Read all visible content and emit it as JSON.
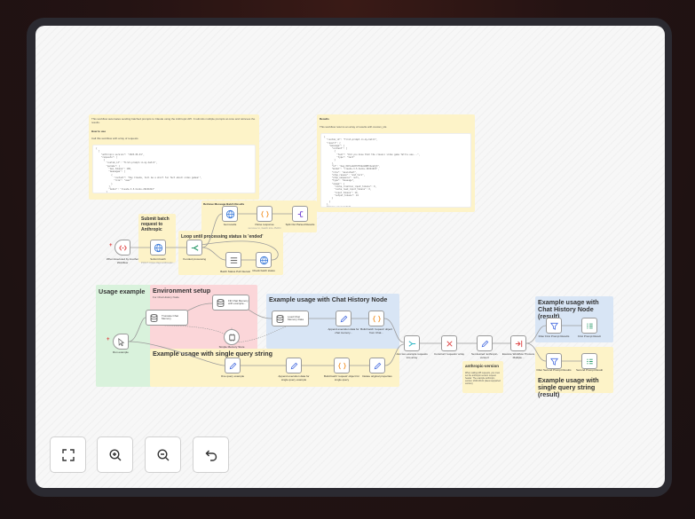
{
  "sticky_notes": {
    "intro": {
      "text": "This workflow automates sending batched prompts to Claude using the Anthropic API. It submits multiple prompts at once and retrieves the results.",
      "how_to_use": "How to use",
      "how_text": "Call this workflow with array of requests",
      "code": "{\n  [\n    \"anthropic-version\": \"2023-06-01\",\n    \"requests\": [\n      {\n        \"custom_id\": \"first-prompt-in-my-batch\",\n        \"params\": {\n          \"max_tokens\": 100,\n          \"messages\": [\n            {\n              \"content\": \"Hey Claude, tell me a short fun fact about video games!\",\n              \"role\": \"user\"\n            }\n          ],\n          \"model\": \"claude-3-5-haiku-20241022\"\n        }\n      }\n    ]\n  }\n}"
    },
    "results": {
      "title": "Results",
      "text": "This workflow returns an array of results with custom_ids",
      "code": "{\n  \"custom_id\": \"first-prompt-in-my-batch\",\n  \"result\": {\n    \"message\": {\n      \"content\": [\n        {\n          \"text\": \"Did you know that the classic video game Tetris was...\",\n          \"type\": \"text\"\n        }\n      ],\n      \"id\": \"msg_01Eia2ZdfZYUkzmQB5tAzeQjX\",\n      \"model\": \"claude-3-5-haiku-20241022\",\n      \"role\": \"assistant\",\n      \"stop_reason\": \"end_turn\",\n      \"stop_sequence\": null,\n      \"type\": \"message\",\n      \"usage\": {\n        \"cache_creation_input_tokens\": 0,\n        \"cache_read_input_tokens\": 0,\n        \"input_tokens\": 19,\n        \"output_tokens\": 41\n      }\n    }\n  },\n  \"type\": \"succeeded\"\n}"
    },
    "submit_batch": "Submit batch request to Anthropic",
    "loop": "Loop until processing status is 'ended'",
    "retrieve": "Retrieve Message Batch Results",
    "usage_example": "Usage example",
    "env_setup": "Environment setup",
    "env_sub": "For Chat History Node",
    "chat_history": "Example usage with Chat History Node",
    "single_query": "Example usage with single query string",
    "chat_history_result": "Example usage with Chat History Node (result)",
    "single_query_result": "Example usage with single query string (result)",
    "anthropic_version": {
      "title": "anthropic-version",
      "text": "When calling API requests, you must set the anthropic-version request header. The example anthropic-version: 2023-06-01 (latest supported version)"
    }
  },
  "nodes": [
    {
      "id": "trigger",
      "label": "When Executed by Another Workflow",
      "icon": "trigger-icon"
    },
    {
      "id": "submit",
      "label": "Submit batch",
      "sub": "POST: https://api.anthropic...",
      "icon": "globe-icon"
    },
    {
      "id": "if_ended",
      "label": "If ended processing",
      "icon": "if-icon"
    },
    {
      "id": "get_results",
      "label": "Get results",
      "icon": "globe-icon"
    },
    {
      "id": "parse",
      "label": "Parse response",
      "sub": "remove \\n, batch into JSON",
      "icon": "code-icon"
    },
    {
      "id": "split",
      "label": "Split Out Parsed Results",
      "icon": "split-icon"
    },
    {
      "id": "batch_status",
      "label": "Batch Status Poll Interval",
      "icon": "wait-icon"
    },
    {
      "id": "check_status",
      "label": "Check batch status",
      "icon": "globe-icon"
    },
    {
      "id": "run_example",
      "label": "Run example",
      "icon": "cursor-icon"
    },
    {
      "id": "truncate",
      "label": "Truncate Chat Memory",
      "icon": "database-icon"
    },
    {
      "id": "fill_memory",
      "label": "Fill Chat Memory with example...",
      "icon": "database-icon"
    },
    {
      "id": "simple_memory",
      "label": "Simple Memory Store",
      "icon": "memory-icon"
    },
    {
      "id": "load_memory",
      "label": "Load Chat Memory Data",
      "icon": "database-icon"
    },
    {
      "id": "append_chat",
      "label": "Append execution data for chat memory...",
      "icon": "pencil-icon"
    },
    {
      "id": "build_chat",
      "label": "Build batch 'request' object from Chat...",
      "icon": "code-icon"
    },
    {
      "id": "one_query",
      "label": "One query example",
      "icon": "pencil-icon"
    },
    {
      "id": "append_single",
      "label": "Append execution data for single query example",
      "icon": "pencil-icon"
    },
    {
      "id": "build_single",
      "label": "Build batch 'request' object for single query",
      "icon": "code-icon"
    },
    {
      "id": "delete_props",
      "label": "Delete original properties",
      "icon": "pencil-icon"
    },
    {
      "id": "join",
      "label": "Join two example requests into array",
      "icon": "merge-icon"
    },
    {
      "id": "construct",
      "label": "Construct 'requests' array",
      "icon": "aggregate-icon"
    },
    {
      "id": "set_version",
      "label": "Set desired 'anthropic-version'",
      "icon": "pencil-icon"
    },
    {
      "id": "execute_wf",
      "label": "Execute Workflow 'Process Multiple...",
      "icon": "workflow-icon"
    },
    {
      "id": "filter_first",
      "label": "Filter First Prompt Results",
      "icon": "filter-icon"
    },
    {
      "id": "first_result",
      "label": "First Prompt Result",
      "icon": "list-icon"
    },
    {
      "id": "filter_second",
      "label": "Filter Second Prompt Results",
      "icon": "filter-icon"
    },
    {
      "id": "second_result",
      "label": "Second Prompt Result",
      "icon": "list-icon"
    }
  ],
  "controls": [
    {
      "name": "fit-view-button",
      "icon": "fit-view-icon"
    },
    {
      "name": "zoom-in-button",
      "icon": "zoom-in-icon"
    },
    {
      "name": "zoom-out-button",
      "icon": "zoom-out-icon"
    },
    {
      "name": "reset-zoom-button",
      "icon": "undo-icon"
    }
  ],
  "colors": {
    "background": "#1b1112",
    "canvas": "#f7f7f7",
    "sticky_yellow": "#fdf3c8",
    "sticky_green": "#d9f2dc",
    "sticky_pink": "#fbd6d9",
    "sticky_blue": "#d8e5f5",
    "http_blue": "#3c7bd9",
    "code_orange": "#f29a38",
    "trigger_red": "#e04c4c",
    "edit_blue": "#4a6fe0",
    "if_green": "#2b9a6a"
  }
}
